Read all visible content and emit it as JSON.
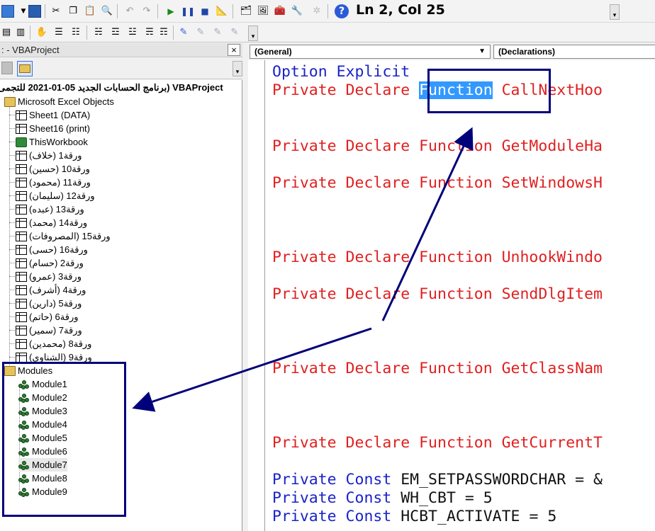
{
  "toolbar": {
    "status": "Ln 2, Col 25",
    "icons": [
      "excel-icon",
      "save-icon",
      "cut-icon",
      "copy-icon",
      "paste-icon",
      "find-icon",
      "undo-icon",
      "redo-icon",
      "run-icon",
      "break-icon",
      "reset-icon",
      "design-mode-icon",
      "project-explorer-icon",
      "properties-icon",
      "object-browser-icon",
      "toolbox-icon",
      "help-icon"
    ],
    "row2_icons": [
      "indent-icon",
      "outdent-icon",
      "hand-icon",
      "comment-icon",
      "uncomment-icon",
      "list-properties-icon",
      "list-constants-icon",
      "quick-info-icon",
      "parameter-info-icon",
      "complete-word-icon",
      "toggle-breakpoint-icon",
      "bookmark-icon",
      "next-bookmark-icon",
      "prev-bookmark-icon"
    ]
  },
  "project": {
    "title": ": - VBAProject",
    "close": "×",
    "root": "VBAProject (برنامج الحسابات الجديد 05-01-2021 للتجمى",
    "excel_objects": "Microsoft Excel Objects",
    "sheets": [
      "Sheet1 (DATA)",
      "Sheet16 (print)",
      "ThisWorkbook",
      "ورقة1 (خلاف)",
      "ورقة10 (حسين)",
      "ورقة11 (محمود)",
      "ورقة12 (سليمان)",
      "ورقة13 (عبده)",
      "ورقة14 (محمد)",
      "ورقة15 (المصروفات)",
      "ورقة16 (حسى)",
      "ورقة2 (حسام)",
      "ورقة3 (عمرو)",
      "ورقة4 (أشرف)",
      "ورقة5 (دارين)",
      "ورقة6 (حاتم)",
      "ورقة7 (سمير)",
      "ورقة8 (محمدين)",
      "ورقة9 (الشناوى)"
    ],
    "modules_folder": "Modules",
    "modules": [
      "Module1",
      "Module2",
      "Module3",
      "Module4",
      "Module5",
      "Module6",
      "Module7",
      "Module8",
      "Module9"
    ]
  },
  "code": {
    "object_combo": "(General)",
    "proc_combo": "(Declarations)",
    "lines": {
      "l1_kw": "Option Explicit",
      "l2_a": "Private Declare ",
      "l2_sel": "Function",
      "l2_b": " CallNextHoo",
      "l3": "Private Declare Function GetModuleHa",
      "l4": "Private Declare Function SetWindowsH",
      "l5": "Private Declare Function UnhookWindo",
      "l6": "Private Declare Function SendDlgItem",
      "l7": "Private Declare Function GetClassNam",
      "l8": "Private Declare Function GetCurrentT",
      "c1_kw": "Private Const",
      "c1_rest": " EM_SETPASSWORDCHAR = &",
      "c2_kw": "Private Const",
      "c2_rest": " WH_CBT = 5",
      "c3_kw": "Private Const",
      "c3_rest": " HCBT_ACTIVATE = 5"
    }
  },
  "colors": {
    "keyword": "#1a23c8",
    "error_line": "#e02020",
    "selection": "#3399ff",
    "annotation": "#00007a"
  }
}
